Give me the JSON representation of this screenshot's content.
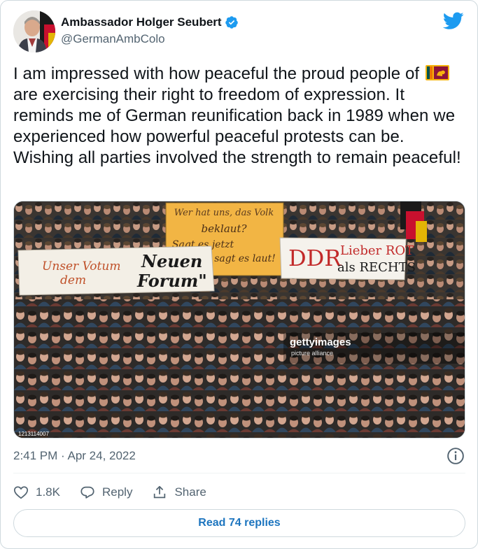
{
  "author": {
    "display_name": "Ambassador Holger Seubert",
    "handle": "@GermanAmbColo",
    "verified": true
  },
  "tweet": {
    "text_before_flag": "I am impressed with how peaceful the proud people of",
    "flag_icon": "sri-lanka-flag-icon",
    "text_after_flag": "are exercising their right to freedom of expression. It reminds me of German reunification back in 1989 when we experienced how powerful peaceful protests can be. Wishing all parties involved the strength to remain peaceful!"
  },
  "media": {
    "description_alt": "",
    "banner_left_line1": "Unser Votum",
    "banner_left_line2": "dem",
    "banner_left_line3": "Neuen",
    "banner_left_line4": "Forum\"",
    "sign_center_line1": "Wer hat uns, das Volk",
    "sign_center_line2": "beklaut?",
    "sign_center_line3": "Sagt es jetzt",
    "sign_center_line4": "sagt es laut!",
    "banner_right_ddr": "DDR",
    "banner_right_line1": "Lieber ROT",
    "banner_right_line2": "als RECHTS",
    "watermark_brand": "gettyimages",
    "watermark_credit": "picture alliance",
    "image_id": "1213114007"
  },
  "meta": {
    "timestamp": "2:41 PM · Apr 24, 2022"
  },
  "actions": {
    "like_count": "1.8K",
    "reply_label": "Reply",
    "share_label": "Share"
  },
  "footer": {
    "read_replies_label": "Read 74 replies"
  },
  "colors": {
    "accent": "#1d9bf0",
    "link": "#1d75bf",
    "secondary_text": "#536471",
    "border": "#cfd9de"
  }
}
